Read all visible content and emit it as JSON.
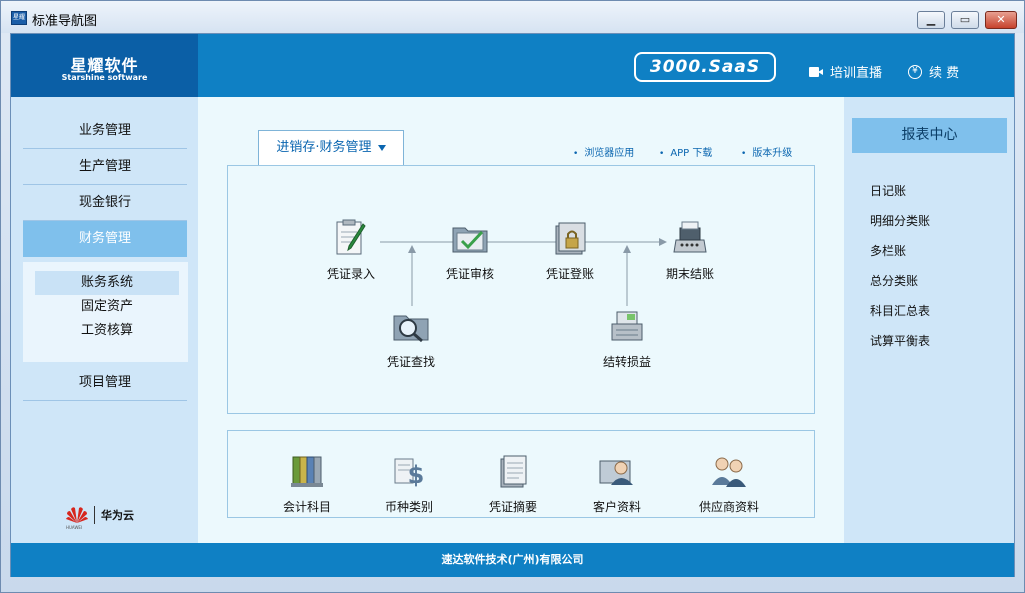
{
  "window": {
    "title": "标准导航图",
    "app_icon_text": "星耀"
  },
  "header": {
    "logo_cn": "星耀软件",
    "logo_en": "Starshine software",
    "edition": "3000.SaaS",
    "training": "培训直播",
    "renew": "续 费",
    "color": "#0f80c4"
  },
  "left_nav": {
    "items": [
      {
        "label": "业务管理"
      },
      {
        "label": "生产管理"
      },
      {
        "label": "现金银行"
      },
      {
        "label": "财务管理",
        "active": true
      },
      {
        "label": "项目管理"
      }
    ],
    "subitems": [
      {
        "label": "账务系统",
        "active": true
      },
      {
        "label": "固定资产"
      },
      {
        "label": "工资核算"
      }
    ],
    "partner": {
      "name": "华为云",
      "small_text": "HUAWEI"
    }
  },
  "main": {
    "tab_label": "进销存·财务管理",
    "quick_links": {
      "browser": "浏览器应用",
      "app": "APP 下载",
      "upgrade": "版本升级"
    },
    "flow": {
      "voucher_entry": "凭证录入",
      "voucher_audit": "凭证审核",
      "voucher_post": "凭证登账",
      "period_close": "期末结账",
      "voucher_search": "凭证查找",
      "transfer_pl": "结转损益"
    },
    "base_data": {
      "accounts": "会计科目",
      "currency": "币种类别",
      "summary": "凭证摘要",
      "customers": "客户资料",
      "suppliers": "供应商资料"
    }
  },
  "reports": {
    "title": "报表中心",
    "items": [
      "日记账",
      "明细分类账",
      "多栏账",
      "总分类账",
      "科目汇总表",
      "试算平衡表"
    ]
  },
  "footer": {
    "company": "速达软件技术(广州)有限公司"
  }
}
